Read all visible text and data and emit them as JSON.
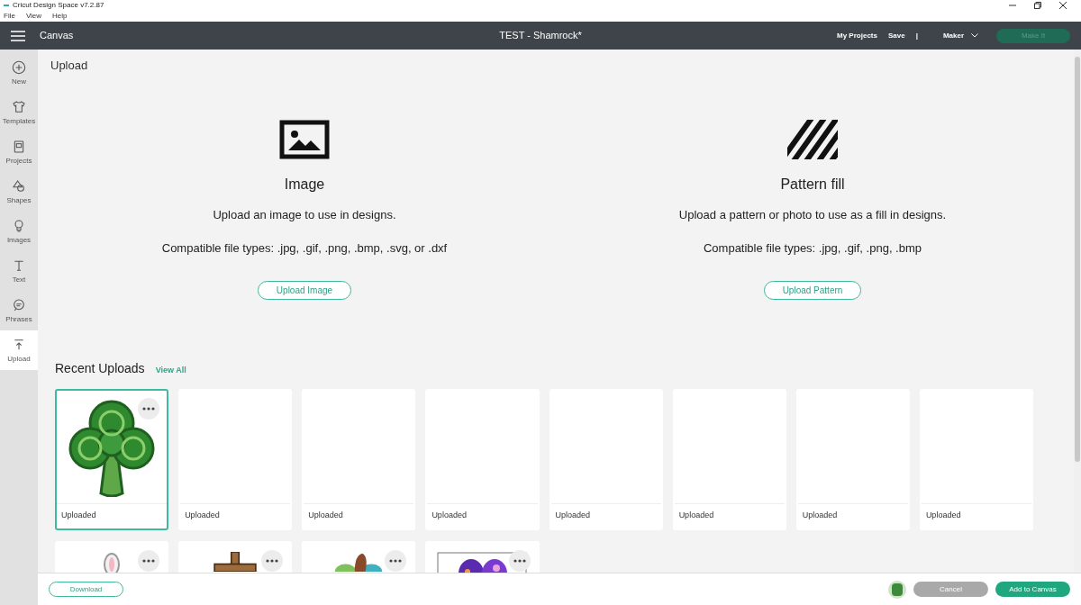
{
  "window": {
    "title": "Cricut Design Space  v7.2.87"
  },
  "menu": [
    "File",
    "View",
    "Help"
  ],
  "header": {
    "section": "Canvas",
    "project": "TEST - Shamrock*",
    "links": [
      "My Projects",
      "Save",
      "|"
    ],
    "machine": "Maker",
    "make_button": "Make It"
  },
  "sidebar": [
    {
      "label": "New",
      "selected": false
    },
    {
      "label": "Templates",
      "selected": false
    },
    {
      "label": "Projects",
      "selected": false
    },
    {
      "label": "Shapes",
      "selected": false
    },
    {
      "label": "Images",
      "selected": false
    },
    {
      "label": "Text",
      "selected": false
    },
    {
      "label": "Phrases",
      "selected": false
    },
    {
      "label": "Upload",
      "selected": true
    }
  ],
  "page_title": "Upload",
  "options": [
    {
      "kind": "image",
      "title": "Image",
      "description": "Upload an image to use in designs.",
      "types": "Compatible file types: .jpg, .gif, .png, .bmp, .svg, or .dxf",
      "button": "Upload Image"
    },
    {
      "kind": "pattern",
      "title": "Pattern fill",
      "description": "Upload a pattern or photo to use as a fill in designs.",
      "types": "Compatible file types: .jpg, .gif, .png, .bmp",
      "button": "Upload Pattern"
    }
  ],
  "recent": {
    "title": "Recent Uploads",
    "view_all": "View All",
    "items": [
      {
        "label": "Uploaded",
        "kind": "shamrock",
        "selected": true
      },
      {
        "label": "Uploaded",
        "kind": "blank",
        "selected": false
      },
      {
        "label": "Uploaded",
        "kind": "blank",
        "selected": false
      },
      {
        "label": "Uploaded",
        "kind": "blank",
        "selected": false
      },
      {
        "label": "Uploaded",
        "kind": "blank",
        "selected": false
      },
      {
        "label": "Uploaded",
        "kind": "blank",
        "selected": false
      },
      {
        "label": "Uploaded",
        "kind": "blank",
        "selected": false
      },
      {
        "label": "Uploaded",
        "kind": "blank",
        "selected": false
      },
      {
        "kind": "bunny",
        "selected": false
      },
      {
        "kind": "cross",
        "selected": false
      },
      {
        "kind": "eggs",
        "selected": false
      },
      {
        "kind": "pattern",
        "selected": false
      }
    ]
  },
  "footer": {
    "download": "Download",
    "cancel": "Cancel",
    "add": "Add to Canvas"
  }
}
